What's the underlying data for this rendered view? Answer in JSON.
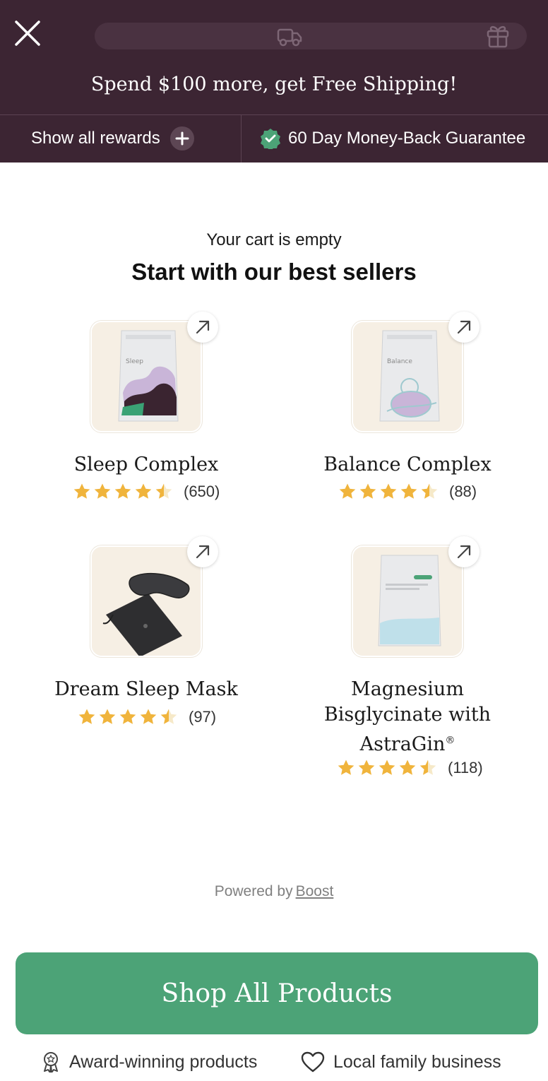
{
  "header": {
    "shipping_message": "Spend $100 more, get Free Shipping!",
    "shipping_progress": 0,
    "rewards_label": "Show all rewards",
    "guarantee_label": "60 Day Money-Back Guarantee",
    "icons": [
      "close-icon",
      "truck-icon",
      "gift-icon",
      "plus-icon",
      "verified-badge-icon"
    ],
    "colors": {
      "background": "#3c2533",
      "track": "#4a3241",
      "guarantee_badge": "#4ca377"
    }
  },
  "main": {
    "empty_message": "Your cart is empty",
    "heading": "Start with our best sellers"
  },
  "products": [
    {
      "name": "Sleep Complex",
      "rating": 4.5,
      "count": "(650)",
      "image": "sleep-pouch"
    },
    {
      "name": "Balance Complex",
      "rating": 4.5,
      "count": "(88)",
      "image": "balance-pouch"
    },
    {
      "name": "Dream Sleep Mask",
      "rating": 4.5,
      "count": "(97)",
      "image": "sleep-mask"
    },
    {
      "name": "Magnesium Bisglycinate with AstraGin®",
      "rating": 4.5,
      "count": "(118)",
      "image": "magnesium-pouch"
    }
  ],
  "footer": {
    "powered_by": "Powered by",
    "powered_link": "Boost",
    "shop_button": "Shop All Products",
    "badges": [
      "Award-winning products",
      "Local family business"
    ],
    "colors": {
      "button": "#4ca377",
      "star": "#f0b43c"
    }
  }
}
